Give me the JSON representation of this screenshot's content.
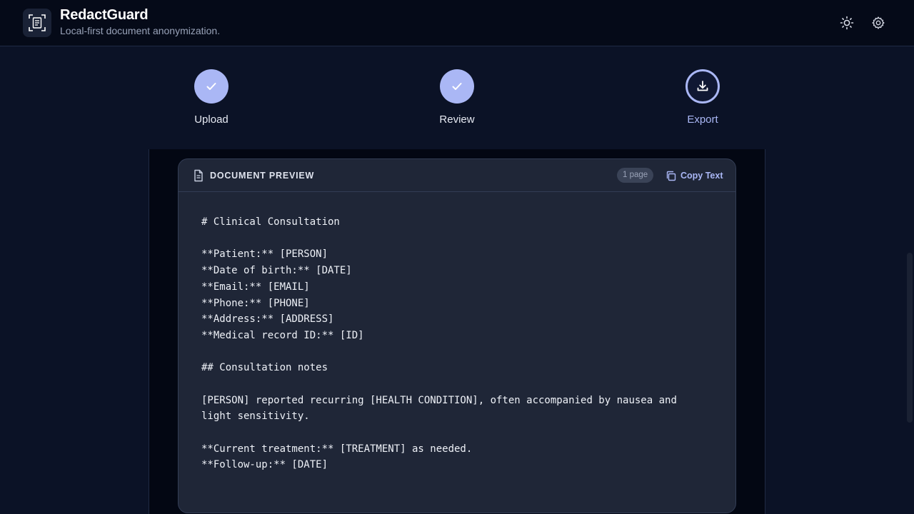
{
  "app": {
    "title": "RedactGuard",
    "subtitle": "Local-first document anonymization."
  },
  "header_actions": [
    {
      "icon": "sun-icon"
    },
    {
      "icon": "gear-icon"
    }
  ],
  "stepper": {
    "steps": [
      {
        "label": "Upload",
        "state": "done",
        "icon": "check-icon"
      },
      {
        "label": "Review",
        "state": "done",
        "icon": "check-icon"
      },
      {
        "label": "Export",
        "state": "current",
        "icon": "download-icon"
      }
    ]
  },
  "preview": {
    "title": "DOCUMENT PREVIEW",
    "page_count": "1 page",
    "copy_label": "Copy Text",
    "lines": [
      "# Clinical Consultation",
      "",
      "**Patient:** [PERSON]",
      "**Date of birth:** [DATE]",
      "**Email:** [EMAIL]",
      "**Phone:** [PHONE]",
      "**Address:** [ADDRESS]",
      "**Medical record ID:** [ID]",
      "",
      "## Consultation notes",
      "",
      "[PERSON] reported recurring [HEALTH CONDITION], often accompanied by nausea and",
      "light sensitivity.",
      "",
      "**Current treatment:** [TREATMENT] as needed.",
      "**Follow-up:** [DATE]"
    ]
  },
  "colors": {
    "accent": "#aab7f5",
    "background": "#0b1226",
    "header": "#050a18",
    "card": "#1f2637"
  }
}
